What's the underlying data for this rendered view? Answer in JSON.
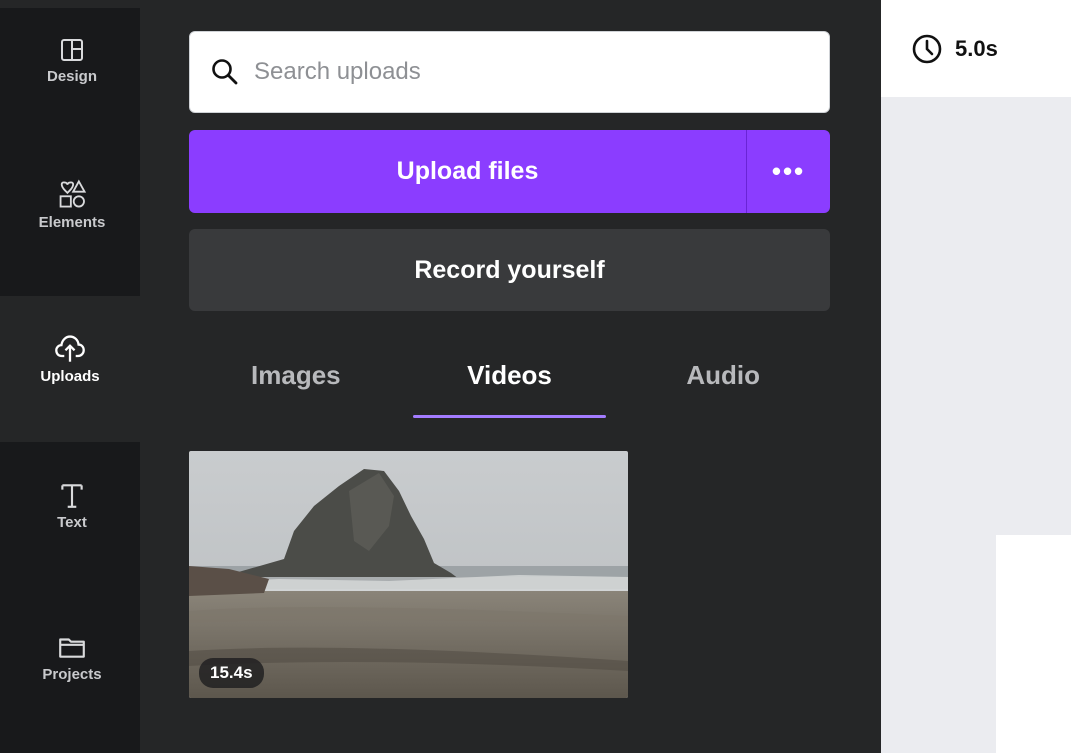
{
  "nav": {
    "items": [
      {
        "label": "Design",
        "icon": "layout-icon"
      },
      {
        "label": "Elements",
        "icon": "shapes-icon"
      },
      {
        "label": "Uploads",
        "icon": "cloud-upload-icon"
      },
      {
        "label": "Text",
        "icon": "text-icon"
      },
      {
        "label": "Projects",
        "icon": "folder-icon"
      }
    ],
    "active": "Uploads"
  },
  "search": {
    "placeholder": "Search uploads",
    "value": ""
  },
  "upload": {
    "label": "Upload files",
    "more_label": "•••"
  },
  "record": {
    "label": "Record yourself"
  },
  "tabs": [
    {
      "label": "Images"
    },
    {
      "label": "Videos"
    },
    {
      "label": "Audio"
    }
  ],
  "active_tab": "Videos",
  "videos": [
    {
      "duration": "15.4s"
    }
  ],
  "topbar": {
    "duration": "5.0s"
  },
  "colors": {
    "accent": "#8b3dff",
    "tab_underline": "#a37cff",
    "rail_bg": "#18191b",
    "panel_bg": "#252627"
  }
}
